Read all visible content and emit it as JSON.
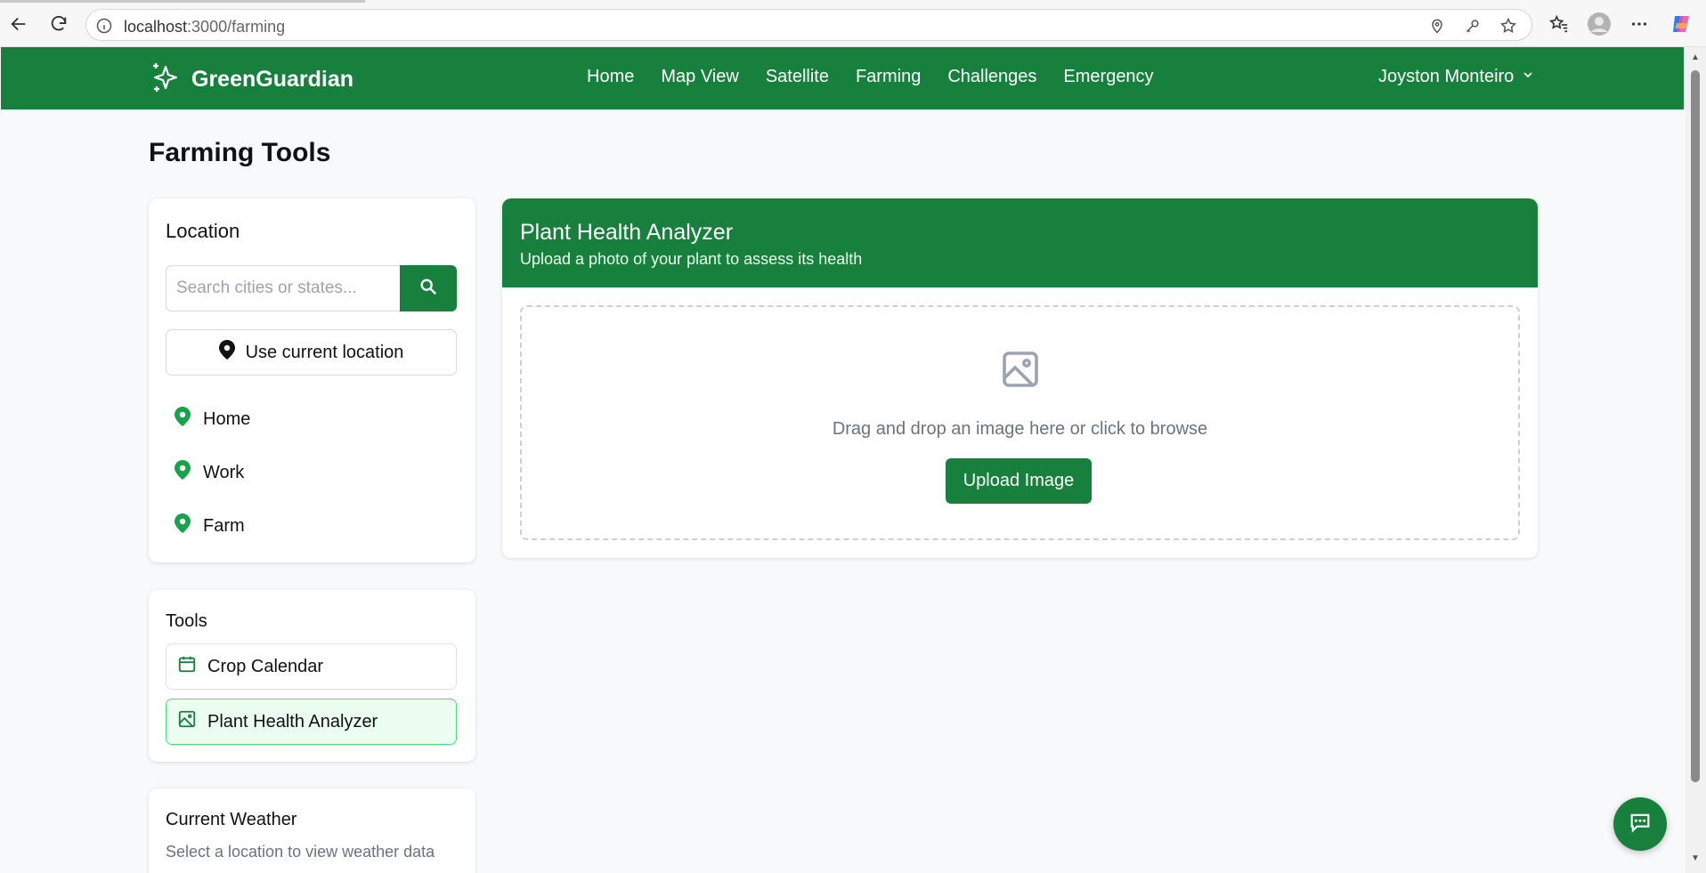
{
  "browser": {
    "url_host": "localhost",
    "url_path": ":3000/farming"
  },
  "header": {
    "brand": "GreenGuardian",
    "nav": [
      "Home",
      "Map View",
      "Satellite",
      "Farming",
      "Challenges",
      "Emergency"
    ],
    "user": "Joyston Monteiro"
  },
  "page": {
    "title": "Farming Tools"
  },
  "location": {
    "heading": "Location",
    "search_placeholder": "Search cities or states...",
    "use_current": "Use current location",
    "saved": [
      "Home",
      "Work",
      "Farm"
    ]
  },
  "tools": {
    "heading": "Tools",
    "items": [
      "Crop Calendar",
      "Plant Health Analyzer"
    ],
    "active": "Plant Health Analyzer"
  },
  "weather": {
    "heading": "Current Weather",
    "message": "Select a location to view weather data"
  },
  "analyzer": {
    "title": "Plant Health Analyzer",
    "subtitle": "Upload a photo of your plant to assess its health",
    "drop_text": "Drag and drop an image here or click to browse",
    "upload_label": "Upload Image"
  },
  "colors": {
    "brand_green": "#16803c",
    "active_bg": "#ecfdf2"
  }
}
